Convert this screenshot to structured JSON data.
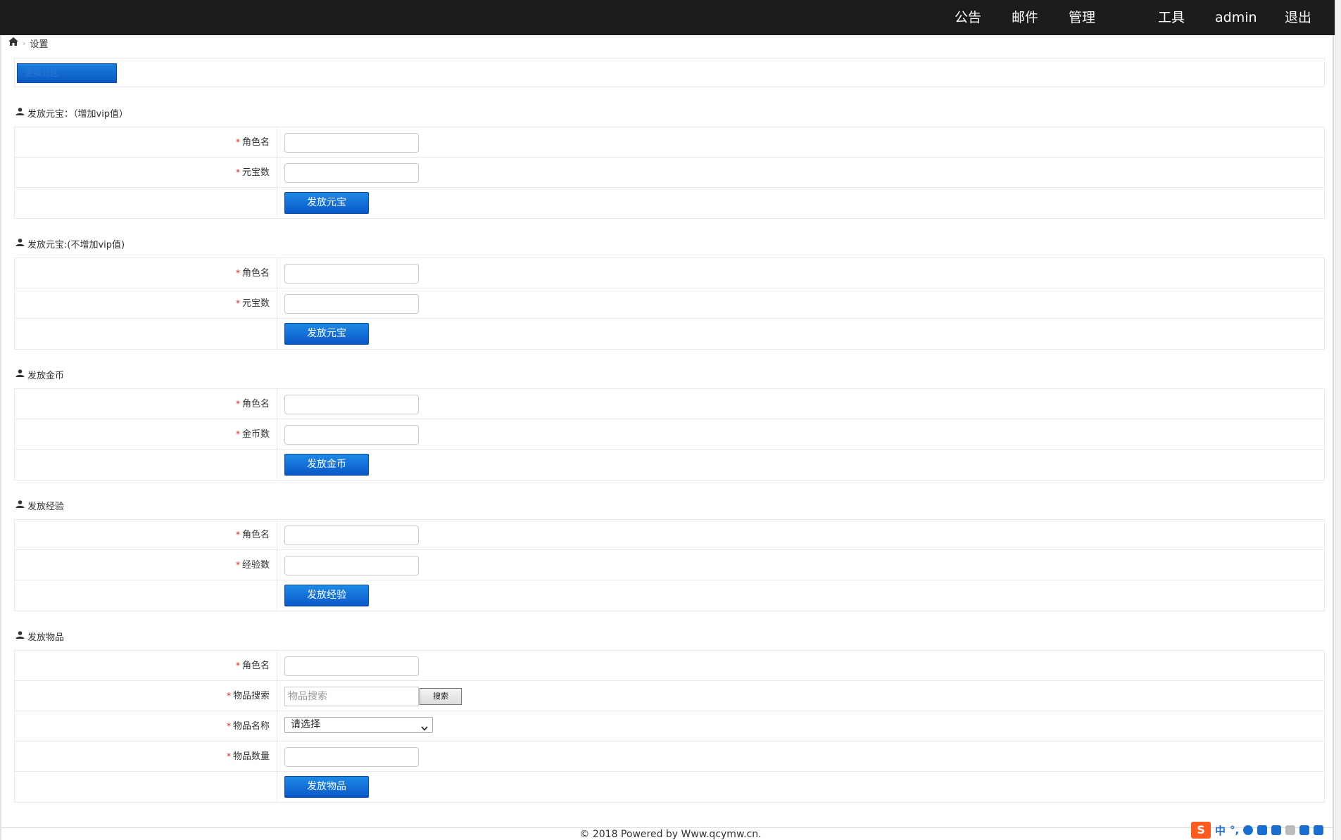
{
  "topnav": [
    "公告",
    "邮件",
    "管理",
    "工具",
    "admin",
    "退出"
  ],
  "breadcrumb": {
    "current": "设置"
  },
  "switch_button": "更换分区",
  "sections": [
    {
      "title": "发放元宝：（增加vip值）",
      "fields": [
        {
          "label": "角色名",
          "kind": "text"
        },
        {
          "label": "元宝数",
          "kind": "text"
        }
      ],
      "submit": "发放元宝"
    },
    {
      "title": "发放元宝:(不增加vip值)",
      "fields": [
        {
          "label": "角色名",
          "kind": "text"
        },
        {
          "label": "元宝数",
          "kind": "text"
        }
      ],
      "submit": "发放元宝"
    },
    {
      "title": "发放金币",
      "fields": [
        {
          "label": "角色名",
          "kind": "text"
        },
        {
          "label": "金币数",
          "kind": "text"
        }
      ],
      "submit": "发放金币"
    },
    {
      "title": "发放经验",
      "fields": [
        {
          "label": "角色名",
          "kind": "text"
        },
        {
          "label": "经验数",
          "kind": "text"
        }
      ],
      "submit": "发放经验"
    },
    {
      "title": "发放物品",
      "fields": [
        {
          "label": "角色名",
          "kind": "text"
        },
        {
          "label": "物品搜索",
          "kind": "search",
          "placeholder": "物品搜索",
          "button": "搜索"
        },
        {
          "label": "物品名称",
          "kind": "select",
          "value": "请选择"
        },
        {
          "label": "物品数量",
          "kind": "text"
        }
      ],
      "submit": "发放物品"
    }
  ],
  "required_mark": "*",
  "footer": "© 2018 Powered by Www.qcymw.cn.",
  "ime_toolbar": {
    "logo": "S",
    "mode": "中",
    "punct": "°,"
  },
  "colors": {
    "topbar": "#1c1c1c",
    "button_blue": "#0a58c8",
    "required": "#e02020"
  }
}
